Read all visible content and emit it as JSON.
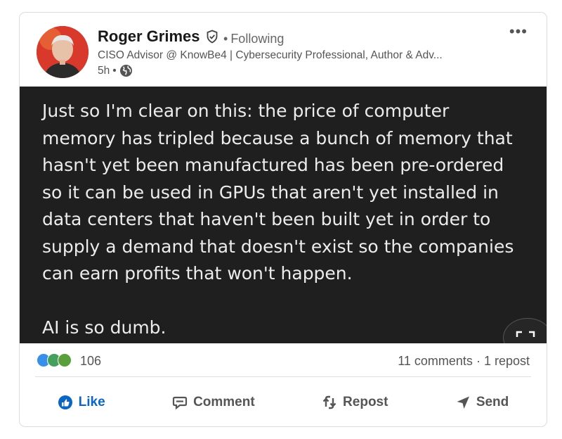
{
  "author": {
    "name": "Roger Grimes",
    "follow_status": "Following",
    "headline": "CISO Advisor @ KnowBe4 | Cybersecurity Professional, Author & Adv...",
    "time": "5h"
  },
  "post": {
    "text": "Just so I'm clear on this:  the price of computer\nmemory has tripled because a bunch of memory that\nhasn't yet been manufactured has been pre-ordered\nso it can be used in GPUs that aren't yet installed in\ndata centers that haven't been built yet in order to\nsupply a demand that doesn't exist so the companies\ncan earn profits that won't happen.\n\nAI is so dumb."
  },
  "social": {
    "reactions": "106",
    "comments": "11 comments",
    "reposts": "1 repost"
  },
  "actions": {
    "like": "Like",
    "comment": "Comment",
    "repost": "Repost",
    "send": "Send"
  },
  "colors": {
    "accent": "#0a66c2",
    "image_bg": "#1f1f1f",
    "image_text": "#ececec"
  },
  "icons": [
    "verified-icon",
    "globe-icon",
    "more-icon",
    "like-icon",
    "comment-icon",
    "repost-icon",
    "send-icon",
    "expand-icon"
  ]
}
